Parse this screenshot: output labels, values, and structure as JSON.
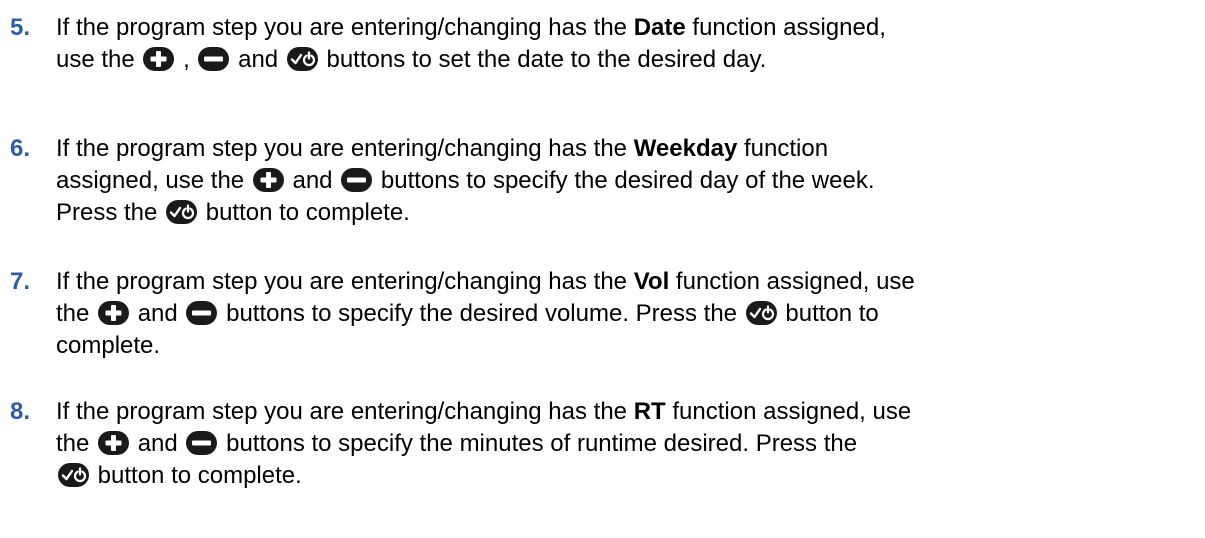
{
  "steps": [
    {
      "number": "5.",
      "p1": "If the program step you are entering/changing has the ",
      "bold": "Date",
      "p2": " function assigned,",
      "p3": "use the ",
      "sep1": " , ",
      "sep2": " and ",
      "p4": " buttons to set the date to the desired day."
    },
    {
      "number": "6.",
      "p1": "If the program step you are entering/changing has the ",
      "bold": "Weekday",
      "p2": " function",
      "p3": "assigned, use the ",
      "sep1": " and ",
      "p4": " buttons to specify the desired day of the week.",
      "p5": "Press the ",
      "p6": " button to complete."
    },
    {
      "number": "7.",
      "p1": "If the program step you are entering/changing has the ",
      "bold": "Vol",
      "p2": " function assigned, use",
      "p3": "the ",
      "sep1": " and ",
      "p4": " buttons to specify the desired volume.  Press the ",
      "p5": " button to",
      "p6": "complete."
    },
    {
      "number": "8.",
      "p1": "If the program step you are entering/changing has the ",
      "bold": "RT",
      "p2": " function assigned, use",
      "p3": "the ",
      "sep1": " and ",
      "p4": " buttons to specify the minutes of runtime desired.  Press the",
      "p5": " button to complete."
    }
  ],
  "icons": {
    "plus": "plus-button-icon",
    "minus": "minus-button-icon",
    "confirm": "check-power-button-icon"
  },
  "colors": {
    "step_number": "#2b5ea7",
    "text": "#000000",
    "icon_fill": "#1a1a1a"
  }
}
